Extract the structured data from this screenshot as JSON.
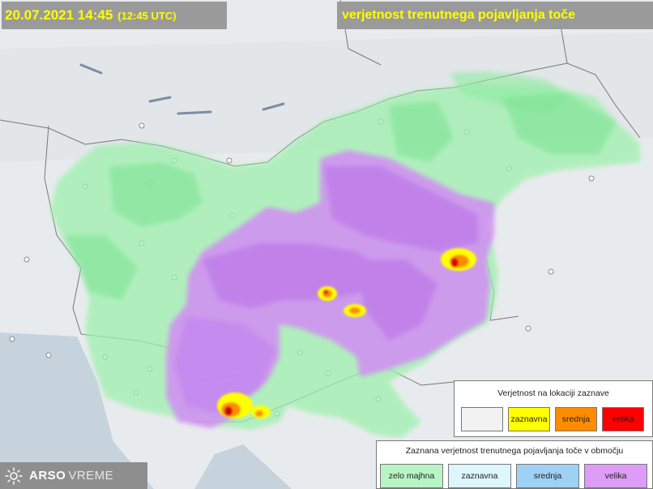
{
  "header": {
    "datetime": "20.07.2021 14:45",
    "utc_time": "(12:45 UTC)",
    "title": "verjetnost trenutnega pojavljanja toče"
  },
  "legend_location": {
    "title": "Verjetnost na lokaciji zaznave",
    "items": [
      {
        "label": "",
        "color": "#f2f2f2"
      },
      {
        "label": "zaznavna",
        "color": "#ffff00"
      },
      {
        "label": "srednja",
        "color": "#ff8c00"
      },
      {
        "label": "velika",
        "color": "#ff0000"
      }
    ]
  },
  "legend_area": {
    "title": "Zaznana verjetnost trenutnega pojavljanja toče v območju",
    "items": [
      {
        "label": "zelo majhna",
        "color": "#b8f5c4"
      },
      {
        "label": "zaznavna",
        "color": "#dcf6fb"
      },
      {
        "label": "srednja",
        "color": "#9fd1f5"
      },
      {
        "label": "velika",
        "color": "#dd9cf7"
      }
    ]
  },
  "logo": {
    "part1": "ARSO",
    "part2": "VREME"
  },
  "icons": {
    "logo_icon": "sun-icon"
  },
  "colors": {
    "title_bg": "#9a9a9a",
    "title_text": "#ffff00",
    "area_low": "#9ef0ae",
    "area_high": "#d28cf5",
    "hail_low": "#ffff00",
    "hail_mid": "#ff8c00",
    "hail_high": "#ff0000"
  }
}
